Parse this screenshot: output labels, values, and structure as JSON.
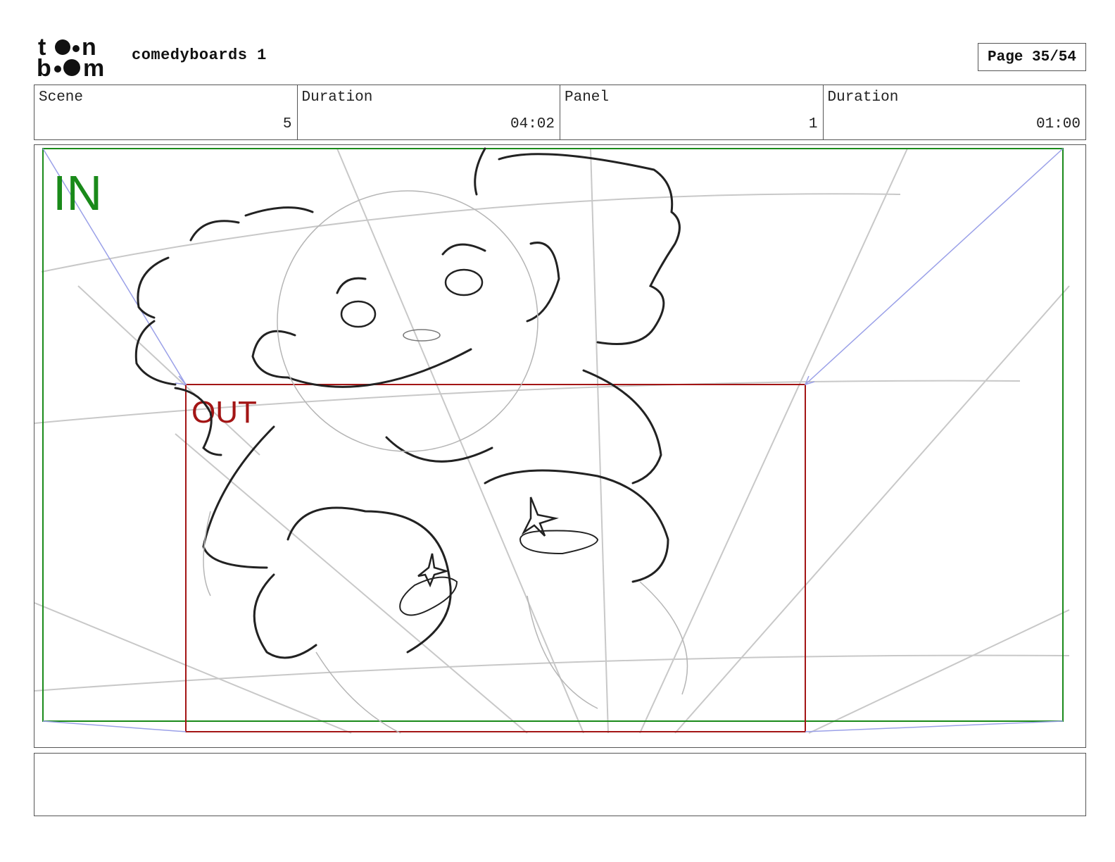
{
  "header": {
    "logo_text": "toon boom",
    "project_title": "comedyboards 1",
    "page_label": "Page 35/54"
  },
  "info": {
    "scene_label": "Scene",
    "scene_value": "5",
    "duration_label": "Duration",
    "duration_value": "04:02",
    "panel_label": "Panel",
    "panel_value": "1",
    "panel_duration_label": "Duration",
    "panel_duration_value": "01:00"
  },
  "panel": {
    "in_label": "IN",
    "out_label": "OUT",
    "in_color": "#1a8a1a",
    "out_color": "#a31515",
    "camera_arrow_color": "#9aa0e8"
  },
  "caption": {
    "text": ""
  }
}
